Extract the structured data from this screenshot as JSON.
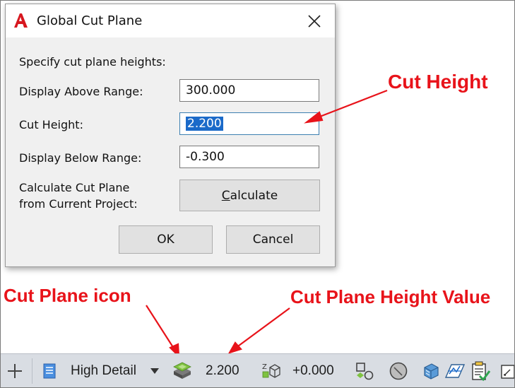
{
  "dialog": {
    "title": "Global Cut Plane",
    "instruction": "Specify cut plane heights:",
    "display_above_label": "Display Above Range:",
    "display_above_value": "300.000",
    "cut_height_label": "Cut Height:",
    "cut_height_value": "2.200",
    "display_below_label": "Display Below Range:",
    "display_below_value": "-0.300",
    "calculate_label_line1": "Calculate Cut Plane",
    "calculate_label_line2": "from Current Project:",
    "calculate_button_first": "C",
    "calculate_button_rest": "alculate",
    "ok_button": "OK",
    "cancel_button": "Cancel"
  },
  "annotations": {
    "cut_height": "Cut Height",
    "cut_plane_icon": "Cut Plane icon",
    "cut_plane_height_value": "Cut Plane Height Value"
  },
  "statusbar": {
    "detail_level": "High Detail",
    "cut_plane_value": "2.200",
    "elevation_value": "+0.000"
  },
  "colors": {
    "annotation": "#e8131a",
    "selection": "#1b6ac9",
    "autodesk_red": "#d7171f",
    "statusbar_bg": "#d9dde3"
  },
  "icons": {
    "app": "autocad-a-icon",
    "close": "close-icon",
    "add": "plus-icon",
    "display_config": "display-configuration-icon",
    "dropdown": "chevron-down-icon",
    "cut_plane": "cut-plane-icon",
    "elevation": "elevation-icon",
    "annotation": "annotation-scale-icon",
    "circle": "circle-icon",
    "box": "box-icon",
    "workspace": "workspace-icon",
    "check": "checklist-icon",
    "more": "more-icon"
  }
}
